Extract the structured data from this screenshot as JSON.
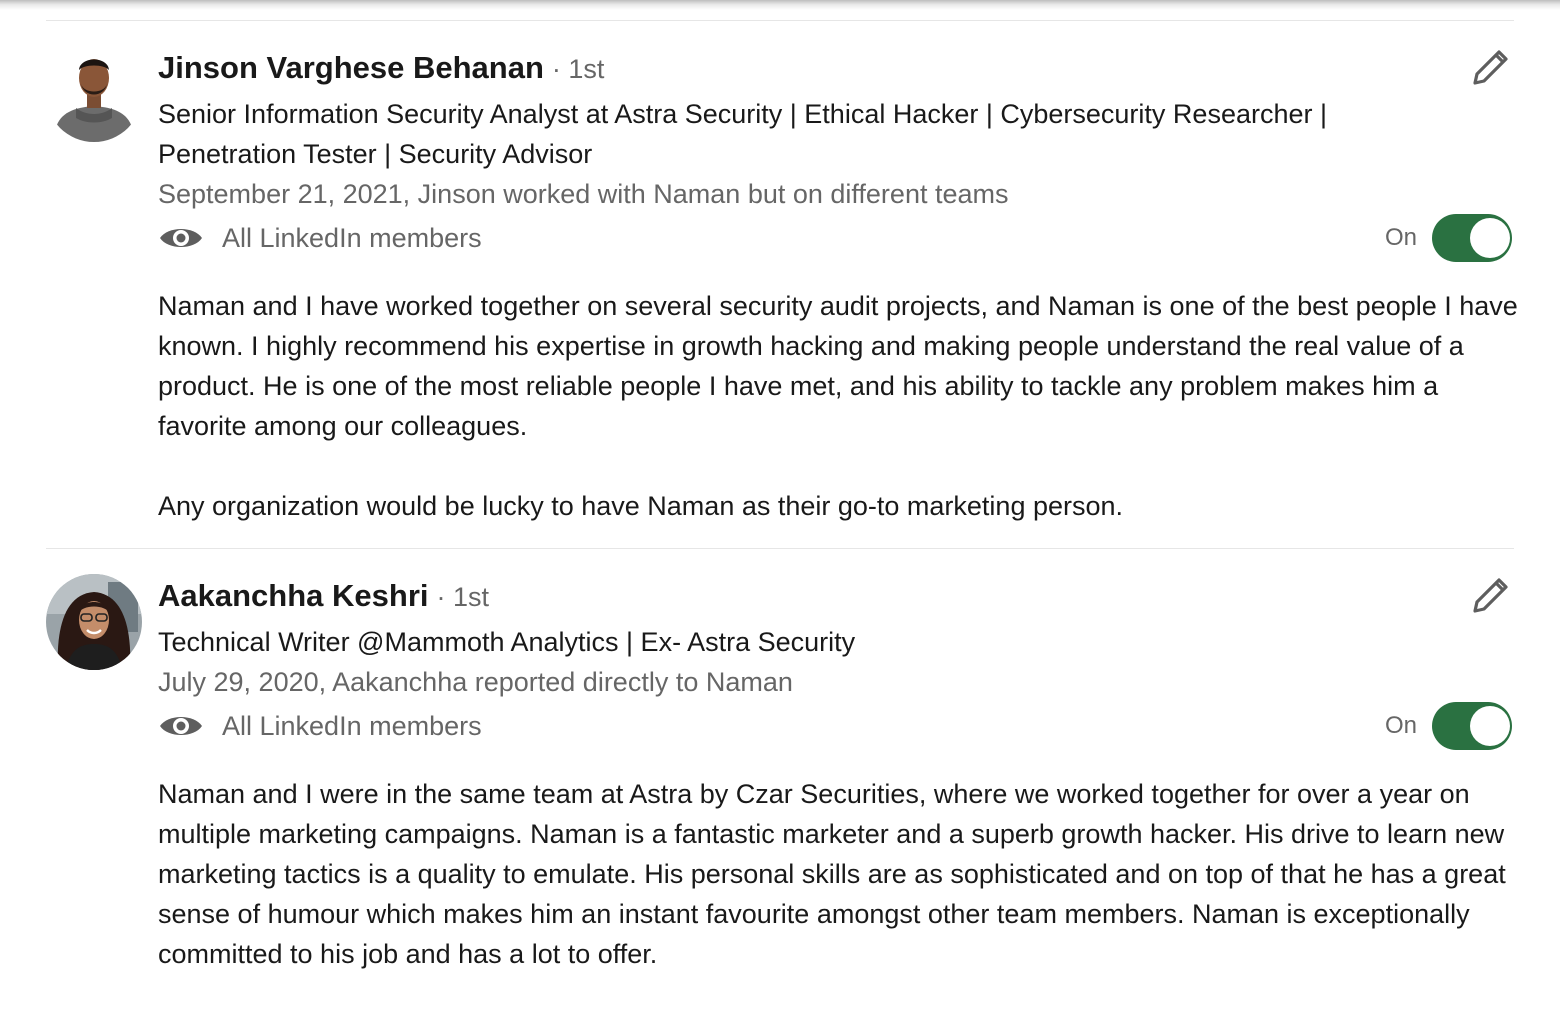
{
  "recommendations": [
    {
      "name": "Jinson Varghese Behanan",
      "degree": "· 1st",
      "headline": "Senior Information Security Analyst at Astra Security | Ethical Hacker | Cybersecurity Researcher | Penetration Tester | Security Advisor",
      "meta": "September 21, 2021, Jinson worked with Naman but on different teams",
      "visibility": "All LinkedIn members",
      "toggle_label": "On",
      "toggle_on": true,
      "paragraphs": [
        "Naman and I have worked together on several security audit projects, and Naman is one of the best people I have known. I highly recommend his expertise in growth hacking and making people understand the real value of a product. He is one of the most reliable people I have met, and his ability to tackle any problem makes him a favorite among our colleagues.",
        "Any organization would be lucky to have Naman as their go-to marketing person."
      ]
    },
    {
      "name": "Aakanchha Keshri",
      "degree": "· 1st",
      "headline": "Technical Writer @Mammoth Analytics | Ex- Astra Security",
      "meta": "July 29, 2020, Aakanchha reported directly to Naman",
      "visibility": "All LinkedIn members",
      "toggle_label": "On",
      "toggle_on": true,
      "paragraphs": [
        "Naman and I were in the same team at Astra by Czar Securities, where we worked together for over a year on multiple marketing campaigns. Naman is a fantastic marketer and a superb growth hacker. His drive to learn new marketing tactics is a quality to emulate. His personal skills are as sophisticated and on top of that he has a great sense of humour which makes him an instant favourite amongst other team members. Naman is exceptionally committed to his job and has a lot to offer."
      ]
    }
  ],
  "icons": {
    "edit": "pencil-icon",
    "visibility": "eye-icon"
  },
  "colors": {
    "toggle_on": "#2a7141",
    "secondary_text": "#666666",
    "primary_text": "#191919"
  }
}
